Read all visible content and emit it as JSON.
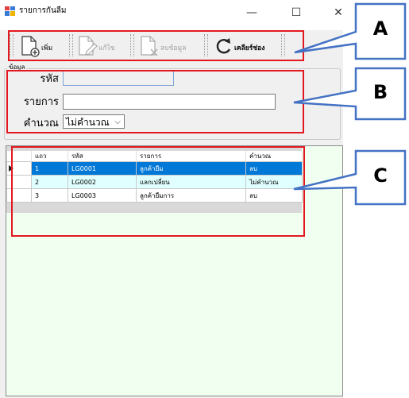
{
  "window": {
    "title": "รายการกันลืม",
    "minimize": "—",
    "maximize": "☐",
    "close": "✕"
  },
  "toolbar": {
    "add_label": "เพิ่ม",
    "edit_label": "แก้ไข",
    "delete_label": "ลบข้อมูล",
    "clear_label": "เคลียร์ช่อง"
  },
  "form": {
    "group_title": "ข้อมูล",
    "code_label": "รหัส",
    "code_value": "",
    "item_label": "รายการ",
    "item_value": "",
    "calc_label": "คำนวณ",
    "calc_value": "ไม่คำนวณ"
  },
  "grid": {
    "columns": [
      "แถว",
      "รหัส",
      "รายการ",
      "คำนวณ"
    ],
    "rows": [
      [
        "1",
        "LG0001",
        "ลูกค้ายืม",
        "ลบ"
      ],
      [
        "2",
        "LG0002",
        "แลกเปลี่ยน",
        "ไม่คำนวณ"
      ],
      [
        "3",
        "LG0003",
        "ลูกค้ายืมการ",
        "ลบ"
      ]
    ]
  },
  "annotations": {
    "a": "A",
    "b": "B",
    "c": "C",
    "color": "#e3181f",
    "callout_fill": "#ffffff",
    "callout_stroke": "#4472c4"
  }
}
